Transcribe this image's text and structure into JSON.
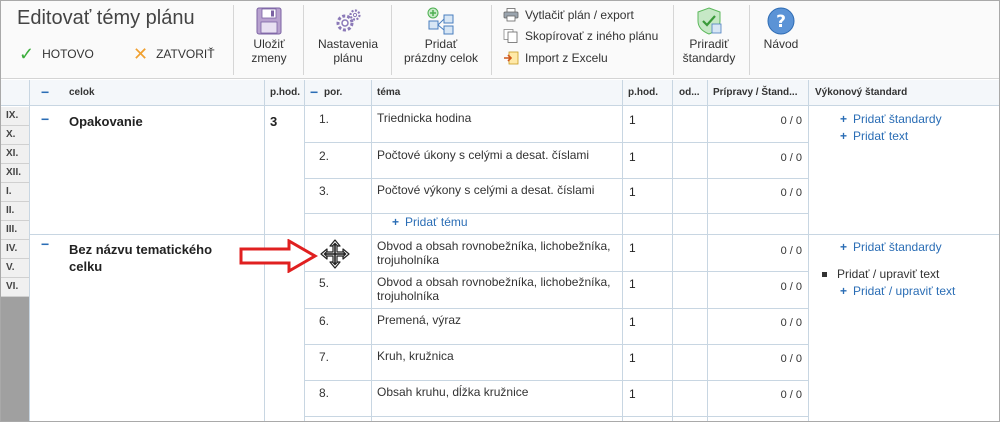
{
  "app": {
    "title": "Editovať témy plánu"
  },
  "toolbar": {
    "done_label": "HOTOVO",
    "close_label": "ZATVORIŤ",
    "save_label_1": "Uložiť",
    "save_label_2": "zmeny",
    "settings_label_1": "Nastavenia",
    "settings_label_2": "plánu",
    "add_unit_label_1": "Pridať",
    "add_unit_label_2": "prázdny celok",
    "print_label": "Vytlačiť plán / export",
    "copy_label": "Skopírovať z iného plánu",
    "import_label": "Import z Excelu",
    "assign_label_1": "Priradiť",
    "assign_label_2": "štandardy",
    "help_label": "Návod"
  },
  "table": {
    "headers": {
      "celok": "celok",
      "phod": "p.hod.",
      "por": "por.",
      "tema": "téma",
      "phod2": "p.hod.",
      "od": "od...",
      "pripravy": "Prípravy / Štand...",
      "vykonovy": "Výkonový štandard"
    },
    "months": [
      "IX.",
      "X.",
      "XI.",
      "XII.",
      "I.",
      "II.",
      "III.",
      "IV.",
      "V.",
      "VI."
    ],
    "units": [
      {
        "name": "Opakovanie",
        "hours": "3",
        "topics": [
          {
            "por": "1.",
            "tema": "Triednicka hodina",
            "phod": "1",
            "prip": "0 / 0"
          },
          {
            "por": "2.",
            "tema": "Počtové úkony s celými a desat. číslami",
            "phod": "1",
            "prip": "0 / 0"
          },
          {
            "por": "3.",
            "tema": "Počtové výkony s celými a desat. číslami",
            "phod": "1",
            "prip": "0 / 0"
          }
        ],
        "add_topic": "Pridať tému",
        "std_links": [
          "Pridať štandardy",
          "Pridať text"
        ]
      },
      {
        "name_line1": "Bez názvu tematického",
        "name_line2": "celku",
        "topics": [
          {
            "por": "",
            "tema_l1": "Obvod a obsah rovnobežníka, lichobežníka,",
            "tema_l2": "trojuholníka",
            "phod": "1",
            "prip": "0 / 0"
          },
          {
            "por": "5.",
            "tema_l1": "Obvod a obsah rovnobežníka, lichobežníka,",
            "tema_l2": "trojuholníka",
            "phod": "1",
            "prip": "0 / 0"
          },
          {
            "por": "6.",
            "tema": "Premená, výraz",
            "phod": "1",
            "prip": "0 / 0"
          },
          {
            "por": "7.",
            "tema": "Kruh, kružnica",
            "phod": "1",
            "prip": "0 / 0"
          },
          {
            "por": "8.",
            "tema": "Obsah kruhu, dĺžka kružnice",
            "phod": "1",
            "prip": "0 / 0"
          }
        ],
        "std_link": "Pridať štandardy",
        "std_text": "Pridať / upraviť text",
        "std_text_link": "Pridať / upraviť text"
      }
    ]
  },
  "colors": {
    "link": "#2a6db5",
    "border": "#c8d6e2",
    "arrow": "#e02020"
  },
  "icons": [
    "check-icon",
    "x-icon",
    "save-icon",
    "gear-icon",
    "add-unit-icon",
    "print-icon",
    "copy-icon",
    "import-icon",
    "shield-icon",
    "help-icon",
    "move-icon"
  ]
}
